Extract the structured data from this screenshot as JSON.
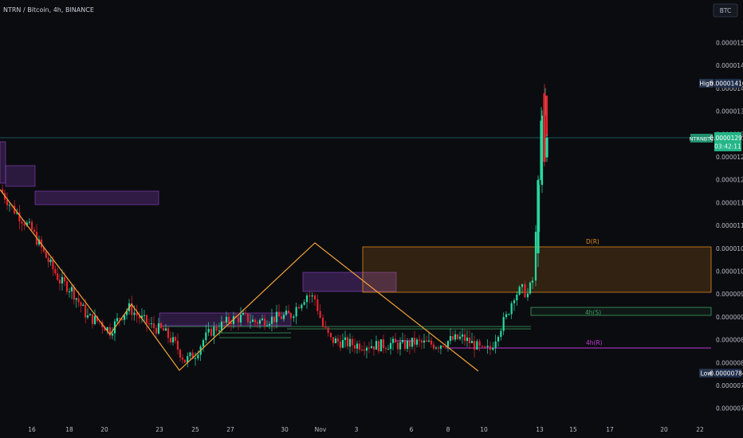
{
  "header": {
    "title": "NTRN / Bitcoin, 4h, BINANCE"
  },
  "currency_button": {
    "label": "BTC"
  },
  "price_badge": {
    "label": "NTRNBTC",
    "price": "0.00001293",
    "countdown": "03:42:11"
  },
  "high_badge": {
    "label": "High",
    "value": "0.00001410"
  },
  "low_badge": {
    "label": "Low",
    "value": "0.00000784"
  },
  "zones": {
    "d_label": "D(R)",
    "s4h_label": "4h(S)",
    "r4h_label": "4h(R)"
  },
  "colors": {
    "bull": "#26d9a0",
    "bear": "#e2252f",
    "zigzag": "#f2a33a",
    "purple": "#8e44c9",
    "green_line": "#3fa060",
    "orange_zone": "#e08a1c",
    "magenta_line": "#c23ad8"
  },
  "chart_data": {
    "type": "candlestick",
    "title": "NTRN / Bitcoin, 4h, BINANCE",
    "yaxis_ticks": [
      "0.00001500",
      "0.00001450",
      "0.00001400",
      "0.00001350",
      "0.00001300",
      "0.00001250",
      "0.00001200",
      "0.00001150",
      "0.00001100",
      "0.00001050",
      "0.00001000",
      "0.00000950",
      "0.00000900",
      "0.00000850",
      "0.00000800",
      "0.00000750",
      "0.00000700"
    ],
    "xaxis_ticks": [
      "16",
      "18",
      "20",
      "23",
      "25",
      "27",
      "30",
      "Nov",
      "3",
      "6",
      "8",
      "10",
      "13",
      "15",
      "17",
      "20",
      "22"
    ],
    "high": 1.41e-05,
    "low": 7.84e-06,
    "last_price": 1.293e-05,
    "approx_close_path": [
      {
        "label": "16",
        "close": 1.19e-05
      },
      {
        "label": "18",
        "close": 9.9e-06
      },
      {
        "label": "20",
        "close": 8.8e-06
      },
      {
        "label": "23",
        "close": 8.7e-06
      },
      {
        "label": "24",
        "close": 8e-06
      },
      {
        "label": "25",
        "close": 8.4e-06
      },
      {
        "label": "27",
        "close": 8.9e-06
      },
      {
        "label": "30",
        "close": 9.1e-06
      },
      {
        "label": "Nov",
        "close": 9.3e-06
      },
      {
        "label": "3",
        "close": 8.5e-06
      },
      {
        "label": "6",
        "close": 8.4e-06
      },
      {
        "label": "8",
        "close": 8.45e-06
      },
      {
        "label": "10",
        "close": 8.3e-06
      },
      {
        "label": "11",
        "close": 9.7e-06
      },
      {
        "label": "13",
        "close": 1.35e-05
      },
      {
        "label": "13b",
        "close": 1.293e-05
      }
    ],
    "levels": [
      {
        "name": "D(R)",
        "from": 9.6e-06,
        "to": 1.06e-05
      },
      {
        "name": "4h(S)",
        "value": 9.2e-06
      },
      {
        "name": "4h(R)",
        "value": 8.45e-06
      }
    ],
    "zigzag": [
      {
        "label": "16",
        "price": 1.18e-05
      },
      {
        "label": "20",
        "price": 8.7e-06
      },
      {
        "label": "21",
        "price": 9.35e-06
      },
      {
        "label": "24",
        "price": 8e-06
      },
      {
        "label": "Nov",
        "price": 1.06e-05
      },
      {
        "label": "10",
        "price": 8e-06
      }
    ]
  }
}
